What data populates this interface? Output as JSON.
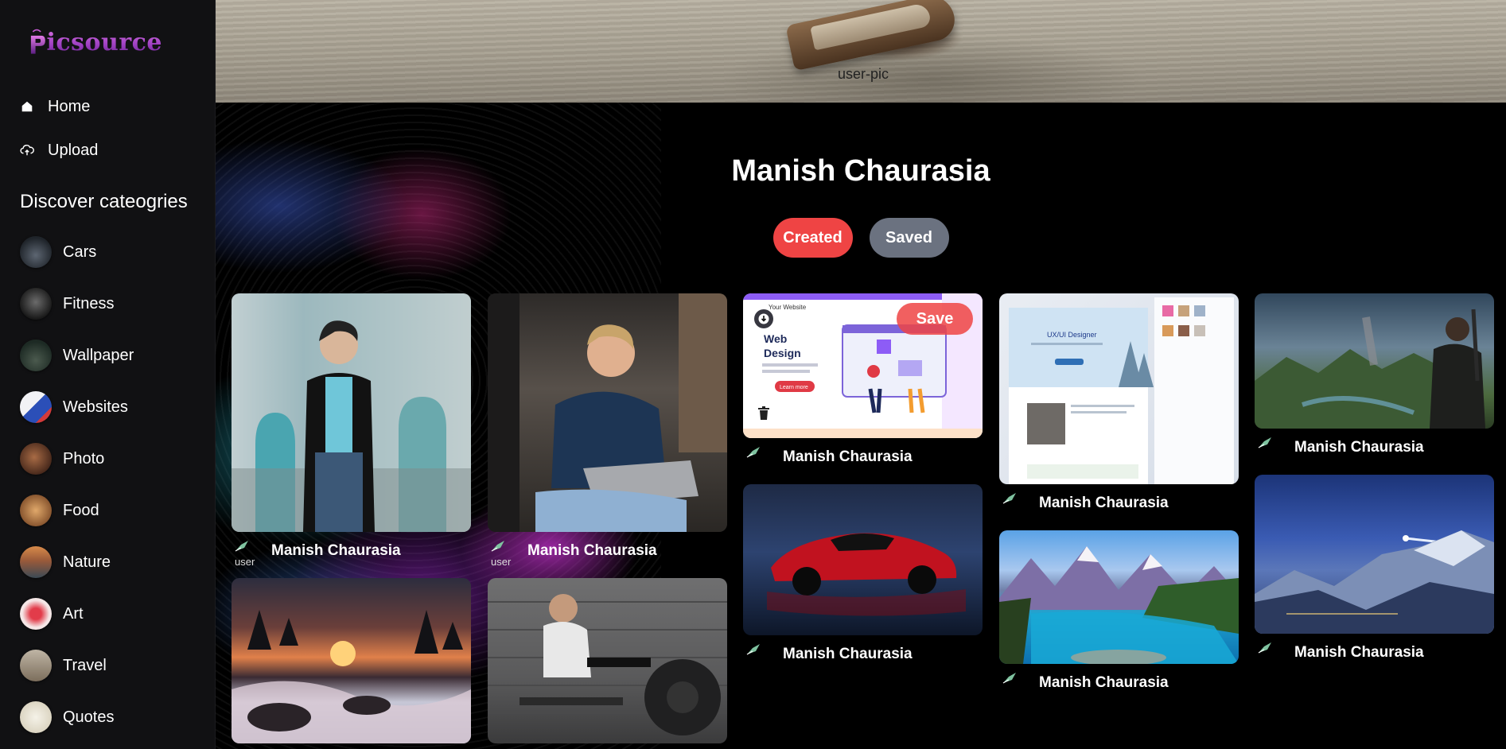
{
  "brand": {
    "name": "icsource",
    "logo_letter": "P"
  },
  "nav": [
    {
      "label": "Home",
      "icon": "home-icon"
    },
    {
      "label": "Upload",
      "icon": "upload-cloud-icon"
    }
  ],
  "discover_title": "Discover cateogries",
  "categories": [
    {
      "label": "Cars"
    },
    {
      "label": "Fitness"
    },
    {
      "label": "Wallpaper"
    },
    {
      "label": "Websites"
    },
    {
      "label": "Photo"
    },
    {
      "label": "Food"
    },
    {
      "label": "Nature"
    },
    {
      "label": "Art"
    },
    {
      "label": "Travel"
    },
    {
      "label": "Quotes"
    }
  ],
  "profile": {
    "cover_alt": "user-pic",
    "name": "Manish Chaurasia"
  },
  "tabs": {
    "created": "Created",
    "saved": "Saved"
  },
  "pins": {
    "author": "Manish Chaurasia",
    "broken_avatar_alt": "user",
    "save_label": "Save",
    "webdesign": {
      "brand": "Your Website",
      "title_line1": "Web",
      "title_line2": "Design",
      "cta": "Learn more"
    },
    "portfolio": {
      "headline": "UX/UI Designer"
    }
  },
  "colors": {
    "accent_red": "#ef4444",
    "tab_gray": "#6b7280",
    "sidebar_bg": "#111113"
  }
}
